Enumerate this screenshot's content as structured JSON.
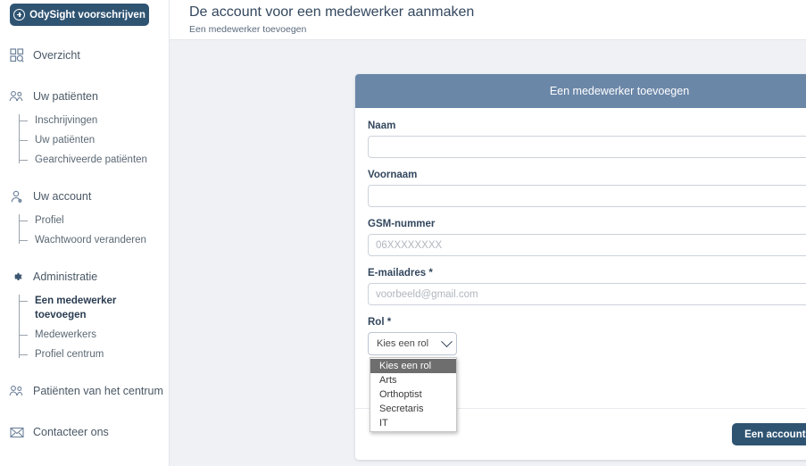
{
  "sidebar": {
    "prescribe_button": {
      "label": "OdySight voorschrijven",
      "icon": "plus-circle-icon"
    },
    "groups": [
      {
        "id": "overzicht",
        "icon": "dashboard-search-icon",
        "label": "Overzicht",
        "children": []
      },
      {
        "id": "uw-patienten",
        "icon": "people-icon",
        "label": "Uw patiënten",
        "children": [
          {
            "label": "Inschrijvingen",
            "active": false
          },
          {
            "label": "Uw patiënten",
            "active": false
          },
          {
            "label": "Gearchiveerde patiënten",
            "active": false
          }
        ]
      },
      {
        "id": "uw-account",
        "icon": "person-icon",
        "label": "Uw account",
        "children": [
          {
            "label": "Profiel",
            "active": false
          },
          {
            "label": "Wachtwoord veranderen",
            "active": false
          }
        ]
      },
      {
        "id": "administratie",
        "icon": "gear-icon",
        "label": "Administratie",
        "children": [
          {
            "label": "Een medewerker toevoegen",
            "active": true
          },
          {
            "label": "Medewerkers",
            "active": false
          },
          {
            "label": "Profiel centrum",
            "active": false
          }
        ]
      },
      {
        "id": "patienten-centrum",
        "icon": "people-icon",
        "label": "Patiënten van het centrum",
        "children": []
      },
      {
        "id": "contacteer-ons",
        "icon": "envelope-icon",
        "label": "Contacteer ons",
        "children": []
      }
    ]
  },
  "header": {
    "title": "De account voor een medewerker aanmaken",
    "subtitle": "Een medewerker toevoegen"
  },
  "form": {
    "card_title": "Een medewerker toevoegen",
    "fields": {
      "naam": {
        "label": "Naam",
        "value": "",
        "placeholder": ""
      },
      "voornaam": {
        "label": "Voornaam",
        "value": "",
        "placeholder": ""
      },
      "gsm": {
        "label": "GSM-nummer",
        "value": "",
        "placeholder": "06XXXXXXXX"
      },
      "email": {
        "label": "E-mailadres *",
        "value": "",
        "placeholder": "voorbeeld@gmail.com"
      },
      "rol": {
        "label": "Rol *",
        "selected": "Kies een rol",
        "open": true,
        "options": [
          "Kies een rol",
          "Arts",
          "Orthoptist",
          "Secretaris",
          "IT"
        ]
      }
    },
    "submit_label": "Een account aanmaken"
  },
  "colors": {
    "brand_dark": "#2f5472",
    "card_header": "#6b87a8",
    "page_bg": "#f0f1f5",
    "text_dark": "#33475e",
    "option_highlight": "#6e6e6e"
  }
}
